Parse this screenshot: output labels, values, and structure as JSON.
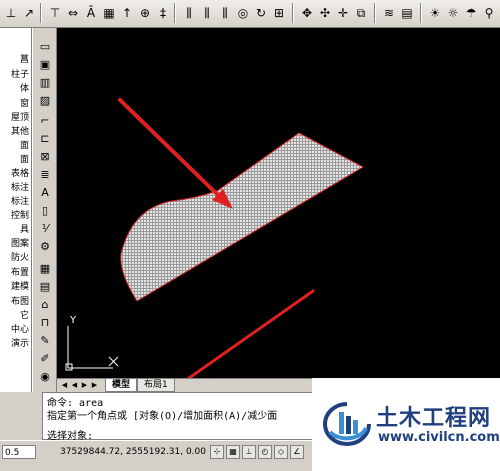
{
  "palette": {
    "items": [
      "菖",
      "柱子",
      "体",
      "窗",
      "屋顶",
      "其他",
      "面",
      "面",
      "表格",
      "标注",
      "标注",
      "控制",
      "具",
      "图案",
      "防火",
      "布置",
      "建模",
      "布图",
      "它",
      "中心",
      "演示"
    ]
  },
  "canvas": {
    "ucs_y_label": "Y",
    "shape_color": "#d8d8d8",
    "outline_color": "#cc2222",
    "arrow_color": "#e02020"
  },
  "tabs": {
    "model": "模型",
    "layout1": "布局1"
  },
  "command": {
    "line1": "命令: area",
    "line2": "指定第一个角点或 [对象(O)/增加面积(A)/减少面",
    "prompt": "选择对象:"
  },
  "status": {
    "scale": "0.5",
    "coords": "37529844.72, 2555192.31, 0.00"
  },
  "watermark": {
    "title": "土木工程网",
    "url": "www.civilcn.com",
    "brand_color": "#1f3f7f"
  },
  "icons": {
    "toolbar": [
      "dimension-icon",
      "leader-icon",
      "align-icon",
      "stretch-icon",
      "text-style-icon",
      "grid-icon",
      "arrow-icon",
      "target-icon",
      "axis-icon",
      "axis-icon",
      "axis-icon",
      "circle-icon",
      "refresh-icon",
      "pan-icon",
      "move-icon",
      "copy-icon",
      "layer-icon",
      "light-icon",
      "lock-icon"
    ],
    "vertical": [
      "line-icon",
      "open-icon",
      "table-icon",
      "image-icon",
      "polyline-icon",
      "offset-icon",
      "block-icon",
      "hatch-icon",
      "text-icon",
      "page-icon",
      "scale-icon",
      "wand-icon",
      "grid-icon",
      "layer-icon",
      "door-icon",
      "shelf-icon",
      "brush-icon",
      "pen-icon",
      "eye-icon"
    ]
  }
}
